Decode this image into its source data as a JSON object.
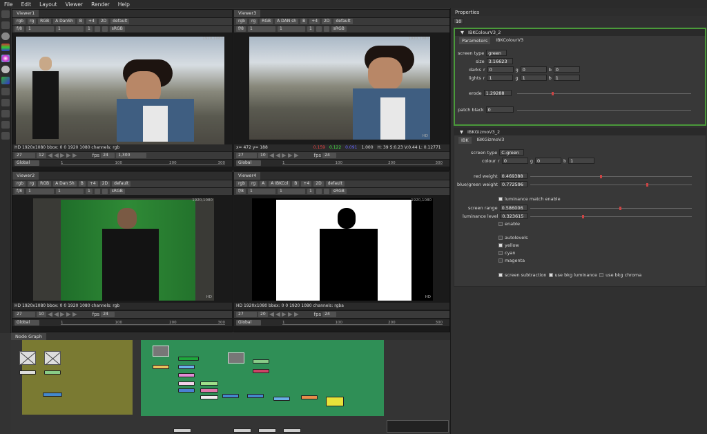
{
  "menu": [
    "File",
    "Edit",
    "Layout",
    "Viewer",
    "Render",
    "Help"
  ],
  "viewers": [
    {
      "title": "Viewer1",
      "ch1": "rgb",
      "ch2": "rg",
      "ch3": "RGB",
      "input_a": "A  DanSh",
      "input_b": "B",
      "gain": "+4",
      "mode": "2D",
      "lut": "default",
      "fstop": "f/8",
      "frame": "1",
      "gamma": "1",
      "proxy": "1",
      "cs": "sRGB",
      "res": "1920,1080",
      "status": "HD 1920x1080 bbox: 0 0 1920 1080 channels: rgb",
      "cur_frame": "27",
      "play_frame": "12",
      "fps": "24",
      "tc": "1,300",
      "scope": "Global",
      "ticks": [
        "1",
        "100",
        "200",
        "300"
      ]
    },
    {
      "title": "Viewer3",
      "ch1": "rgb",
      "ch2": "rg",
      "ch3": "RGB",
      "input_a": "A  DAN sh",
      "input_b": "B",
      "gain": "+4",
      "mode": "2D",
      "lut": "default",
      "fstop": "f/8",
      "frame": "1",
      "gamma": "1",
      "proxy": "1",
      "cs": "sRGB",
      "res": "1920,1080",
      "status": "x= 472 y= 188",
      "pix_r": "0.159",
      "pix_g": "0.122",
      "pix_b": "0.091",
      "pix_a": "1.000",
      "pix_hsv": "H: 39 S:0.23 V:0.44  L: 0.12771",
      "cur_frame": "27",
      "play_frame": "10",
      "fps": "24",
      "scope": "Global",
      "ticks": [
        "1",
        "100",
        "200",
        "300"
      ]
    },
    {
      "title": "Viewer2",
      "ch1": "rgb",
      "ch2": "rg",
      "ch3": "RGB",
      "input_a": "A  Dan Sh",
      "input_b": "B",
      "gain": "+4",
      "mode": "2D",
      "lut": "default",
      "fstop": "f/8",
      "frame": "1",
      "gamma": "1",
      "proxy": "1",
      "cs": "sRGB",
      "res": "1920,1080",
      "status": "HD 1920x1080 bbox: 0 0 1920 1080 channels: rgb",
      "cur_frame": "27",
      "play_frame": "10",
      "fps": "24",
      "scope": "Global",
      "ticks": [
        "1",
        "100",
        "200",
        "300"
      ]
    },
    {
      "title": "Viewer4",
      "ch1": "rgb",
      "ch2": "rg",
      "ch3": "A",
      "input_a": "A  IBKCol",
      "input_b": "B",
      "gain": "+4",
      "mode": "2D",
      "lut": "default",
      "fstop": "f/8",
      "frame": "1",
      "gamma": "1",
      "proxy": "1",
      "cs": "sRGB",
      "res": "1920,1080",
      "status": "HD 1920x1080 bbox: 0 0 1920 1080 channels: rgba",
      "cur_frame": "27",
      "play_frame": "20",
      "fps": "24",
      "scope": "Global",
      "ticks": [
        "1",
        "100",
        "200",
        "300"
      ]
    }
  ],
  "hd_badge": "HD",
  "properties": {
    "title": "Properties",
    "count": "10",
    "ibk_colour": {
      "name": "IBKColourV3_2",
      "tabs": [
        "Parameters",
        "IBKColourV3"
      ],
      "screen_type_label": "screen type",
      "screen_type": "green",
      "size_label": "size",
      "size": "3.16623",
      "darks_label": "darks",
      "lights_label": "lights",
      "darks": {
        "r": "0",
        "g": "0",
        "b": "0"
      },
      "lights": {
        "r": "1",
        "g": "1",
        "b": "1"
      },
      "erode_label": "erode",
      "erode": "1.29288",
      "patch_label": "patch black",
      "patch": "0",
      "rgb_labels": {
        "r": "r",
        "g": "g",
        "b": "b"
      }
    },
    "ibk_gizmo": {
      "name": "IBKGizmoV3_2",
      "tabs": [
        "IBK",
        "IBKGizmoV3"
      ],
      "screen_type_label": "screen type",
      "screen_type": "C-green",
      "colour_label": "colour",
      "colour": {
        "r": "0",
        "g": "0",
        "b": "1"
      },
      "red_weight_label": "red weight",
      "red_weight": "0.469388",
      "bg_weight_label": "blue/green weight",
      "bg_weight": "0.772596",
      "lum_match_label": "luminance match enable",
      "screen_range_label": "screen range",
      "screen_range": "0.586006",
      "lum_level_label": "luminance level",
      "lum_level": "0.323615",
      "enable_label": "enable",
      "autolevels": "autolevels",
      "yellow": "yellow",
      "cyan": "cyan",
      "magenta": "magenta",
      "screen_sub": "screen subtraction",
      "use_bkg_lum": "use bkg luminance",
      "use_bkg_chroma": "use bkg chroma"
    }
  },
  "node_graph": {
    "title": "Node Graph"
  },
  "colors": {
    "backdrop_olive": "#7a7a32",
    "backdrop_green": "#2f8f56",
    "knob_red": "#cc4444",
    "panel_green": "#4a9a3a"
  }
}
